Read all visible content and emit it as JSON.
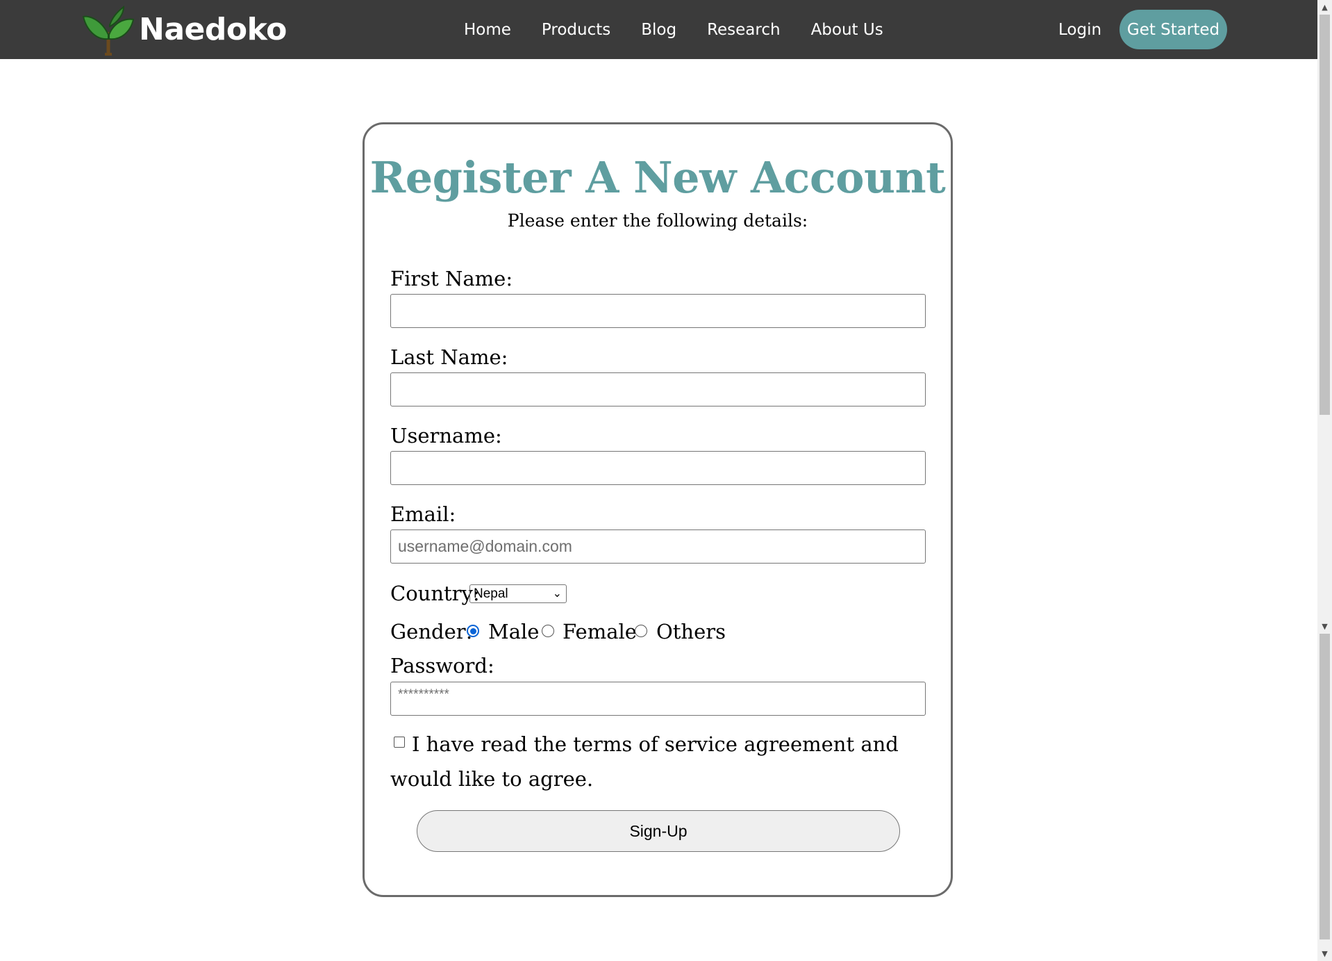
{
  "nav": {
    "brand": "Naedoko",
    "links": [
      "Home",
      "Products",
      "Blog",
      "Research",
      "About Us"
    ],
    "login": "Login",
    "cta": "Get Started"
  },
  "form": {
    "title": "Register A New Account",
    "subtitle": "Please enter the following details:",
    "first_name_label": "First Name:",
    "last_name_label": "Last Name:",
    "username_label": "Username:",
    "email_label": "Email:",
    "email_placeholder": "username@domain.com",
    "country_label": "Country:",
    "country_value": "Nepal",
    "gender_label": "Gender:",
    "gender_options": [
      "Male",
      "Female",
      "Others"
    ],
    "gender_selected": "Male",
    "password_label": "Password:",
    "password_placeholder": "**********",
    "terms_text": "I have read the terms of service agreement and would like to agree.",
    "terms_checked": false,
    "submit_label": "Sign-Up"
  },
  "colors": {
    "nav_bg": "#3b3b3b",
    "accent": "#5f9ea0",
    "radio_selected": "#0b64d6"
  },
  "icons": {
    "logo": "sprout-icon",
    "select_caret": "chevron-down-icon"
  }
}
